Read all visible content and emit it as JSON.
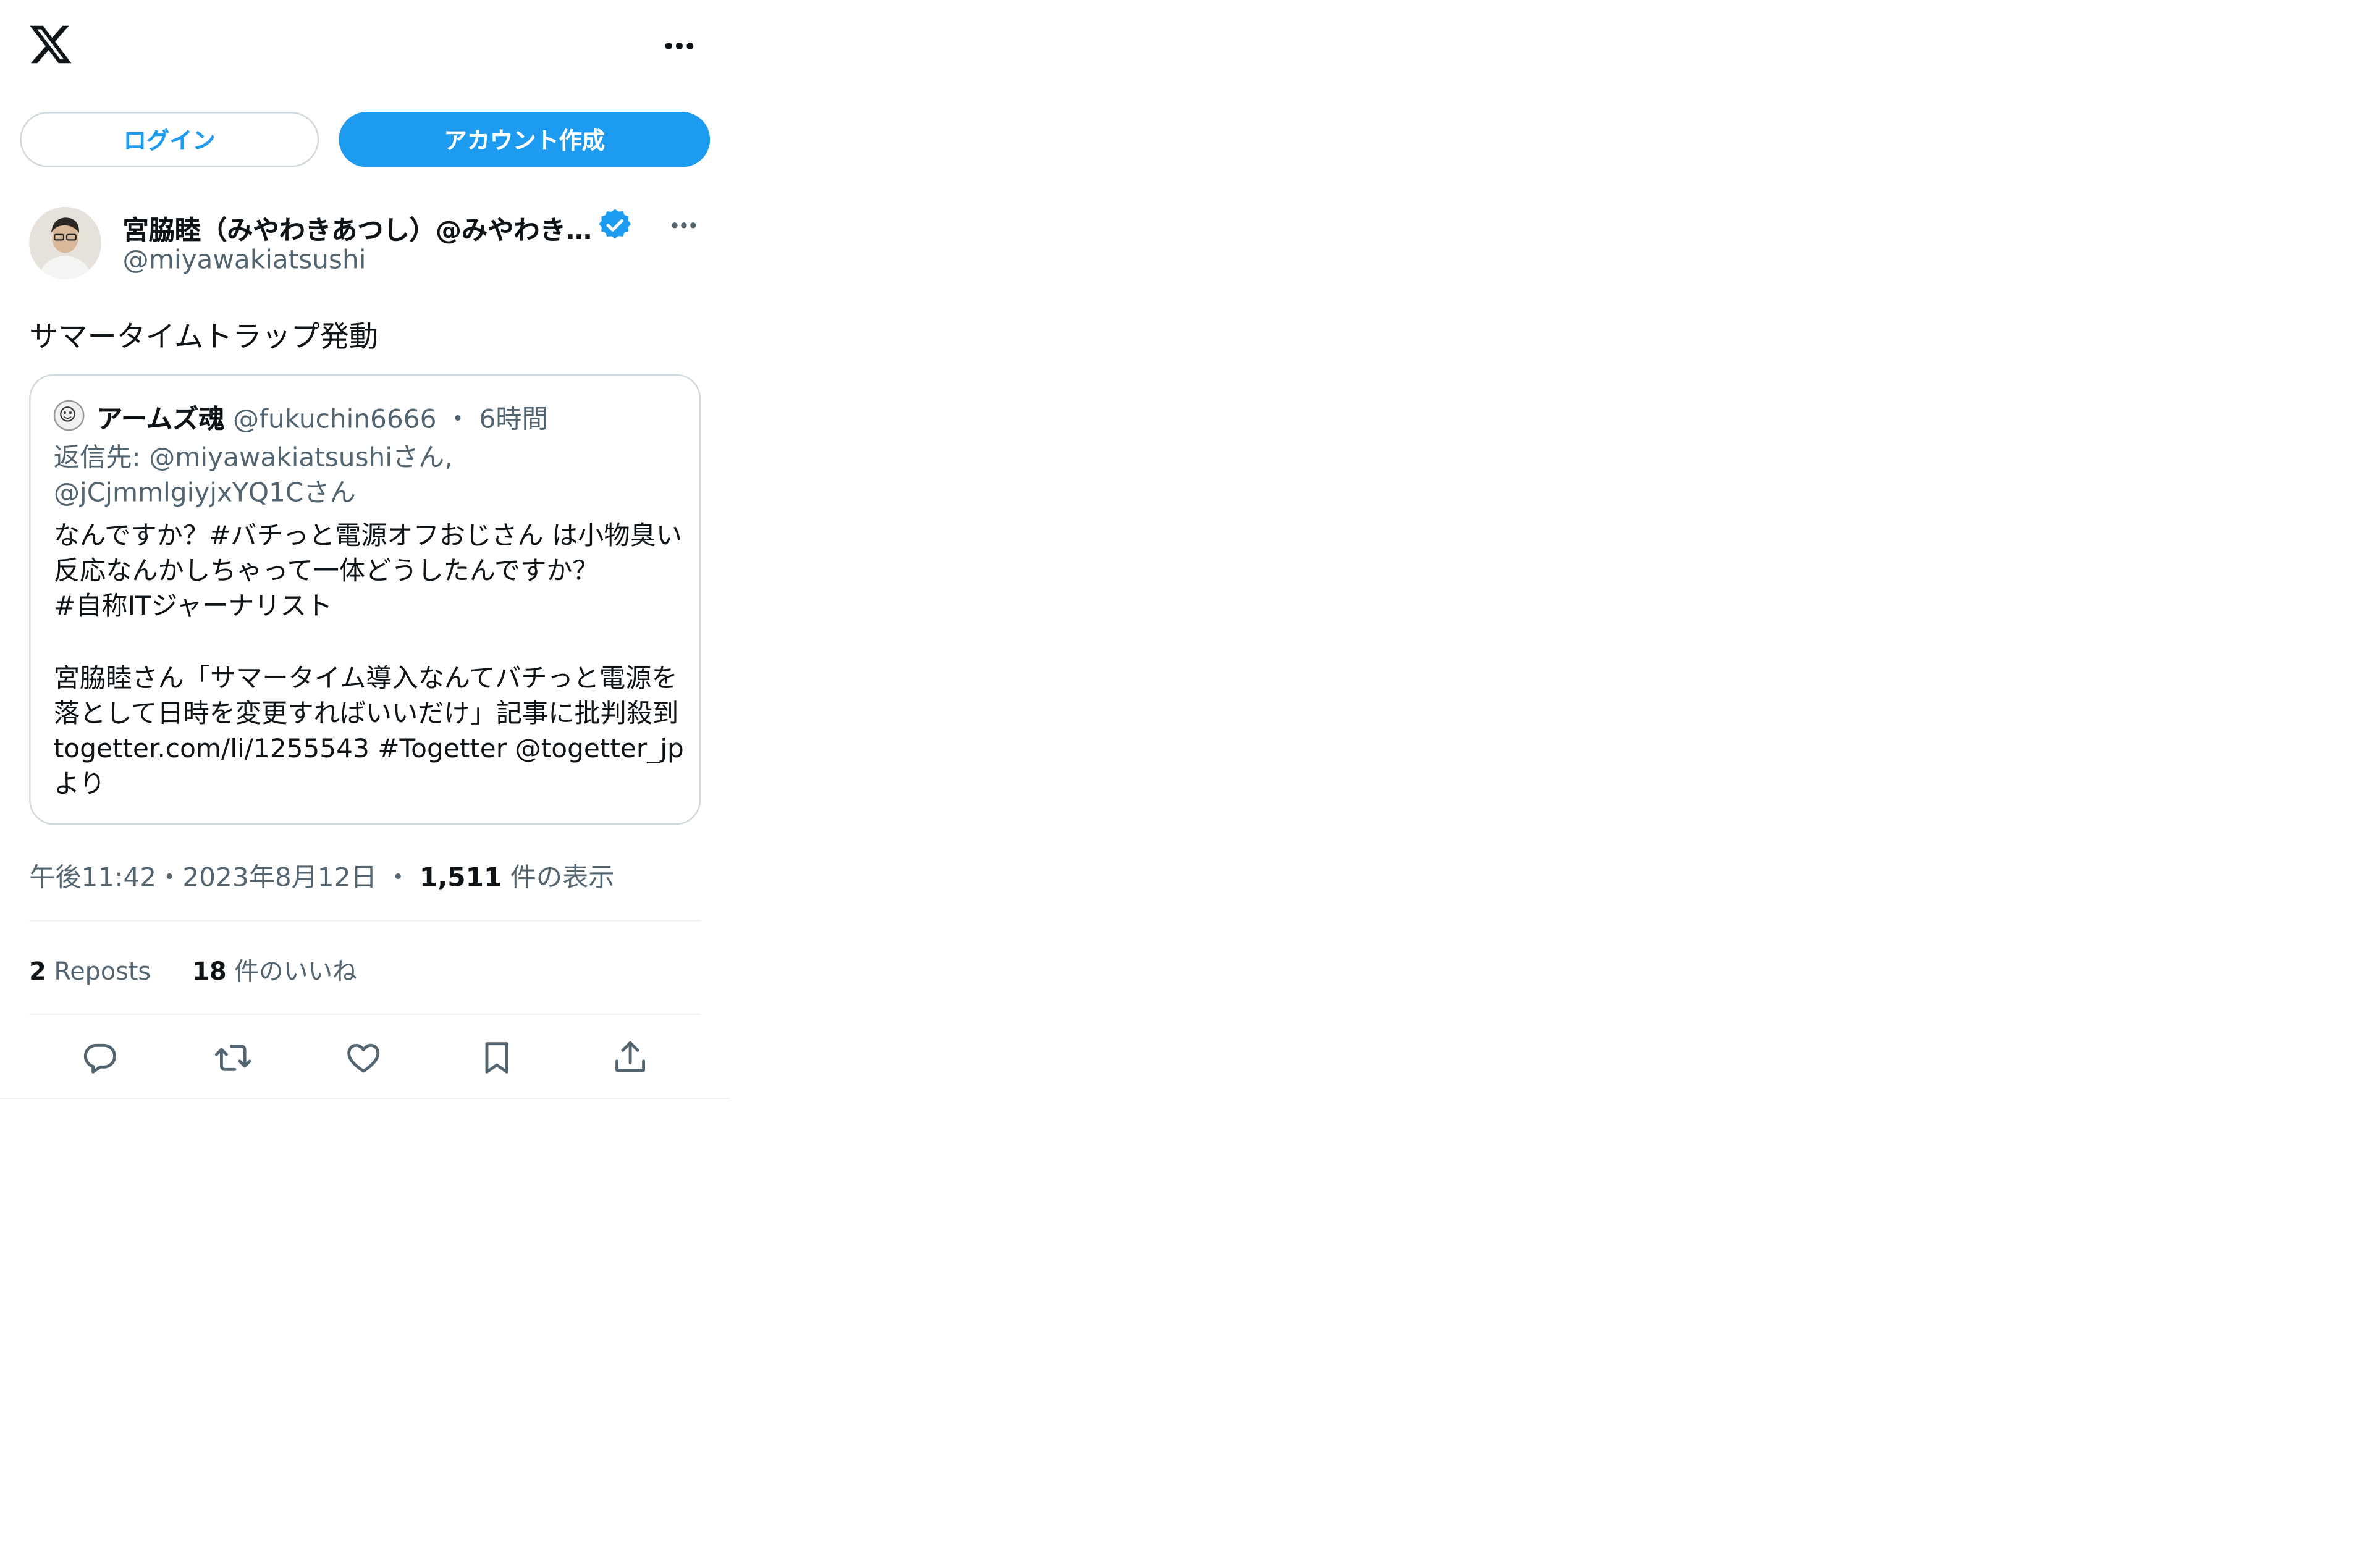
{
  "header": {
    "logo_icon": "x-logo-icon",
    "more_icon": "more-horizontal-icon"
  },
  "buttons": {
    "login": "ログイン",
    "signup": "アカウント作成"
  },
  "colors": {
    "accent": "#1d9bf0",
    "text": "#0f1419",
    "muted": "#536471",
    "border": "#cfd9de"
  },
  "tweet": {
    "author_name": "宮脇睦（みやわきあつし）@みやわき…",
    "author_handle": "@miyawakiatsushi",
    "verified_icon": "verified-badge-icon",
    "text": "サマータイムトラップ発動",
    "quote": {
      "name": "アームズ魂",
      "handle": "@fukuchin6666",
      "dot": "・",
      "time": "6時間",
      "reply_to": "返信先: @miyawakiatsushiさん, @jCjmmlgiyjxYQ1Cさん",
      "body": [
        "なんですか？#バチっと電源オフおじさん は小物臭い反応なんかしちゃって一体どうしたんですか？",
        "#自称ITジャーナリスト",
        "",
        "宮脇睦さん「サマータイム導入なんてバチっと電源を落として日時を変更すればいいだけ」記事に批判殺到 togetter.com/li/1255543 #Togetter @togetter_jpより"
      ]
    },
    "timestamp": "午後11:42・2023年8月12日",
    "views_sep": "・",
    "views_count": "1,511",
    "views_label": " 件の表示",
    "reposts_count": "2",
    "reposts_label": " Reposts",
    "likes_count": "18",
    "likes_label": " 件のいいね"
  },
  "actions": [
    "reply-icon",
    "repost-icon",
    "like-icon",
    "bookmark-icon",
    "share-icon"
  ]
}
